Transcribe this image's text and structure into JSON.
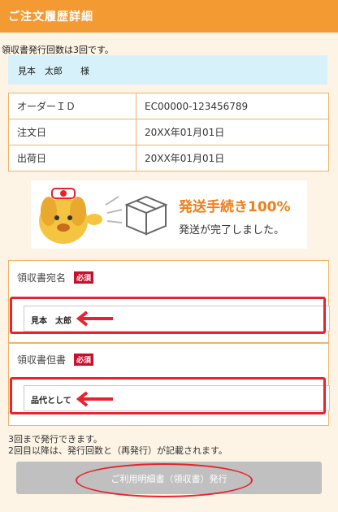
{
  "header": {
    "title": "ご注文履歴詳細"
  },
  "receipt_count_text": "領収書発行回数は3回です。",
  "customer_name": "見本　太郎　　様",
  "order_info": [
    {
      "label": "オーダーＩＤ",
      "value": "EC00000-123456789"
    },
    {
      "label": "注文日",
      "value": "20XX年01月01日"
    },
    {
      "label": "出荷日",
      "value": "20XX年01月01日"
    }
  ],
  "banner": {
    "headline": "発送手続き100%",
    "message": "発送が完了しました。"
  },
  "addressee": {
    "label": "領収書宛名",
    "badge": "必須",
    "value": "見本　太郎"
  },
  "proviso": {
    "label": "領収書但書",
    "badge": "必須",
    "value": "品代として"
  },
  "notes": [
    "3回まで発行できます。",
    "2回目以降は、発行回数と（再発行）が記載されます。"
  ],
  "issue_button": {
    "label": "ご利用明細書（領収書）発行"
  },
  "colors": {
    "header": "#f39a33",
    "accent_orange": "#ef7f1a",
    "required": "#c8102e",
    "annotation": "#e8232d"
  }
}
